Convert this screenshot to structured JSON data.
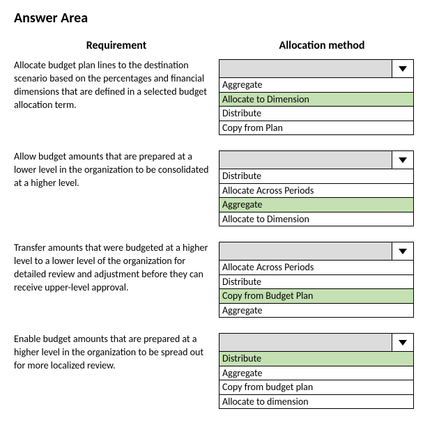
{
  "title": "Answer Area",
  "headers": {
    "requirement": "Requirement",
    "method": "Allocation method"
  },
  "rows": [
    {
      "requirement": "Allocate budget plan lines to the destination scenario based on the percentages and financial dimensions that are defined in a selected budget allocation term.",
      "options": [
        "Aggregate",
        "Allocate to Dimension",
        "Distribute",
        "Copy from Plan"
      ],
      "selected": 1
    },
    {
      "requirement": "Allow budget amounts that are prepared at a lower level in the organization to be consolidated at a higher level.",
      "options": [
        "Distribute",
        "Allocate Across Periods",
        "Aggregate",
        "Allocate to Dimension"
      ],
      "selected": 2
    },
    {
      "requirement": "Transfer amounts that were budgeted at a higher level to a lower level of the organization for detailed review and adjustment before they can receive upper-level approval.",
      "options": [
        "Allocate Across Periods",
        "Distribute",
        "Copy from Budget Plan",
        "Aggregate"
      ],
      "selected": 2
    },
    {
      "requirement": "Enable budget amounts that are prepared at a higher level in the organization to be spread out for more localized review.",
      "options": [
        "Distribute",
        "Aggregate",
        "Copy from budget plan",
        "Allocate to dimension"
      ],
      "selected": 0
    }
  ]
}
